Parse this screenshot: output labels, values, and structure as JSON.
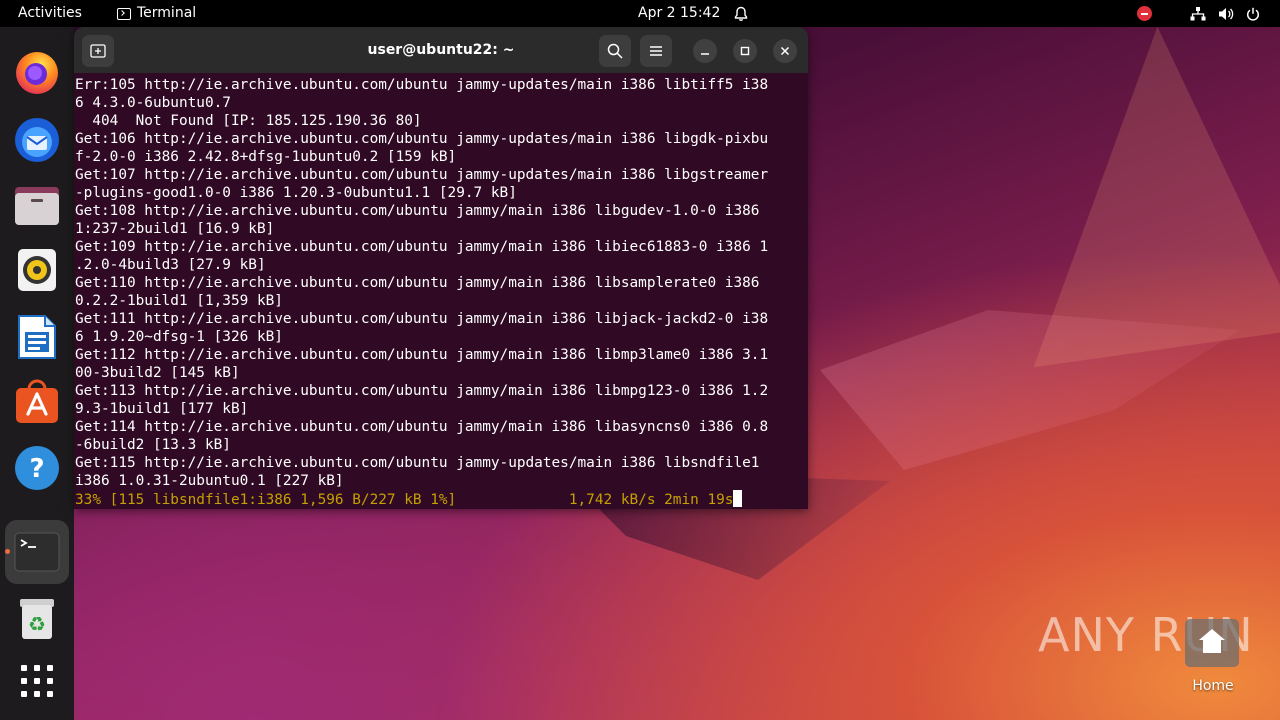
{
  "topbar": {
    "activities": "Activities",
    "app_name": "Terminal",
    "clock": "Apr 2  15:42"
  },
  "dock": {
    "apps": [
      "Firefox",
      "Thunderbird",
      "Files",
      "Rhythmbox",
      "LibreOffice Writer",
      "Ubuntu Software",
      "Help",
      "Terminal",
      "Trash",
      "Show Applications"
    ]
  },
  "terminal": {
    "title": "user@ubuntu22: ~",
    "lines": [
      "Err:105 http://ie.archive.ubuntu.com/ubuntu jammy-updates/main i386 libtiff5 i38",
      "6 4.3.0-6ubuntu0.7",
      "  404  Not Found [IP: 185.125.190.36 80]",
      "Get:106 http://ie.archive.ubuntu.com/ubuntu jammy-updates/main i386 libgdk-pixbu",
      "f-2.0-0 i386 2.42.8+dfsg-1ubuntu0.2 [159 kB]",
      "Get:107 http://ie.archive.ubuntu.com/ubuntu jammy-updates/main i386 libgstreamer",
      "-plugins-good1.0-0 i386 1.20.3-0ubuntu1.1 [29.7 kB]",
      "Get:108 http://ie.archive.ubuntu.com/ubuntu jammy/main i386 libgudev-1.0-0 i386",
      "1:237-2build1 [16.9 kB]",
      "Get:109 http://ie.archive.ubuntu.com/ubuntu jammy/main i386 libiec61883-0 i386 1",
      ".2.0-4build3 [27.9 kB]",
      "Get:110 http://ie.archive.ubuntu.com/ubuntu jammy/main i386 libsamplerate0 i386",
      "0.2.2-1build1 [1,359 kB]",
      "Get:111 http://ie.archive.ubuntu.com/ubuntu jammy/main i386 libjack-jackd2-0 i38",
      "6 1.9.20~dfsg-1 [326 kB]",
      "Get:112 http://ie.archive.ubuntu.com/ubuntu jammy/main i386 libmp3lame0 i386 3.1",
      "00-3build2 [145 kB]",
      "Get:113 http://ie.archive.ubuntu.com/ubuntu jammy/main i386 libmpg123-0 i386 1.2",
      "9.3-1build1 [177 kB]",
      "Get:114 http://ie.archive.ubuntu.com/ubuntu jammy/main i386 libasyncns0 i386 0.8",
      "-6build2 [13.3 kB]",
      "Get:115 http://ie.archive.ubuntu.com/ubuntu jammy-updates/main i386 libsndfile1",
      "i386 1.0.31-2ubuntu0.1 [227 kB]"
    ],
    "status_line": "33% [115 libsndfile1:i386 1,596 B/227 kB 1%]             1,742 kB/s 2min 19s"
  },
  "desktop": {
    "home_label": "Home",
    "watermark": "ANY RUN"
  }
}
